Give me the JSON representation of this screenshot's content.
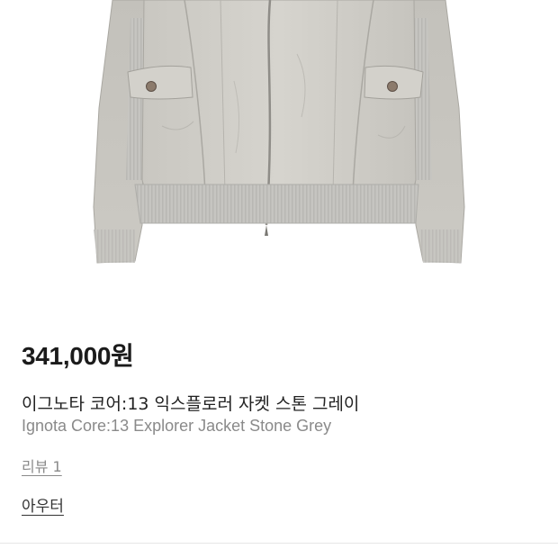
{
  "product": {
    "price": "341,000원",
    "title_ko": "이그노타 코어:13 익스플로러 자켓 스톤 그레이",
    "title_en": "Ignota Core:13 Explorer Jacket Stone Grey",
    "review_link": "리뷰 1",
    "category_link": "아우터"
  },
  "colors": {
    "jacket_main": "#cfcdc7",
    "jacket_shadow": "#b3b1ab",
    "rib_knit": "#c4c3bf",
    "price_text": "#1b1b1b",
    "muted_text": "#8a8a8a"
  }
}
